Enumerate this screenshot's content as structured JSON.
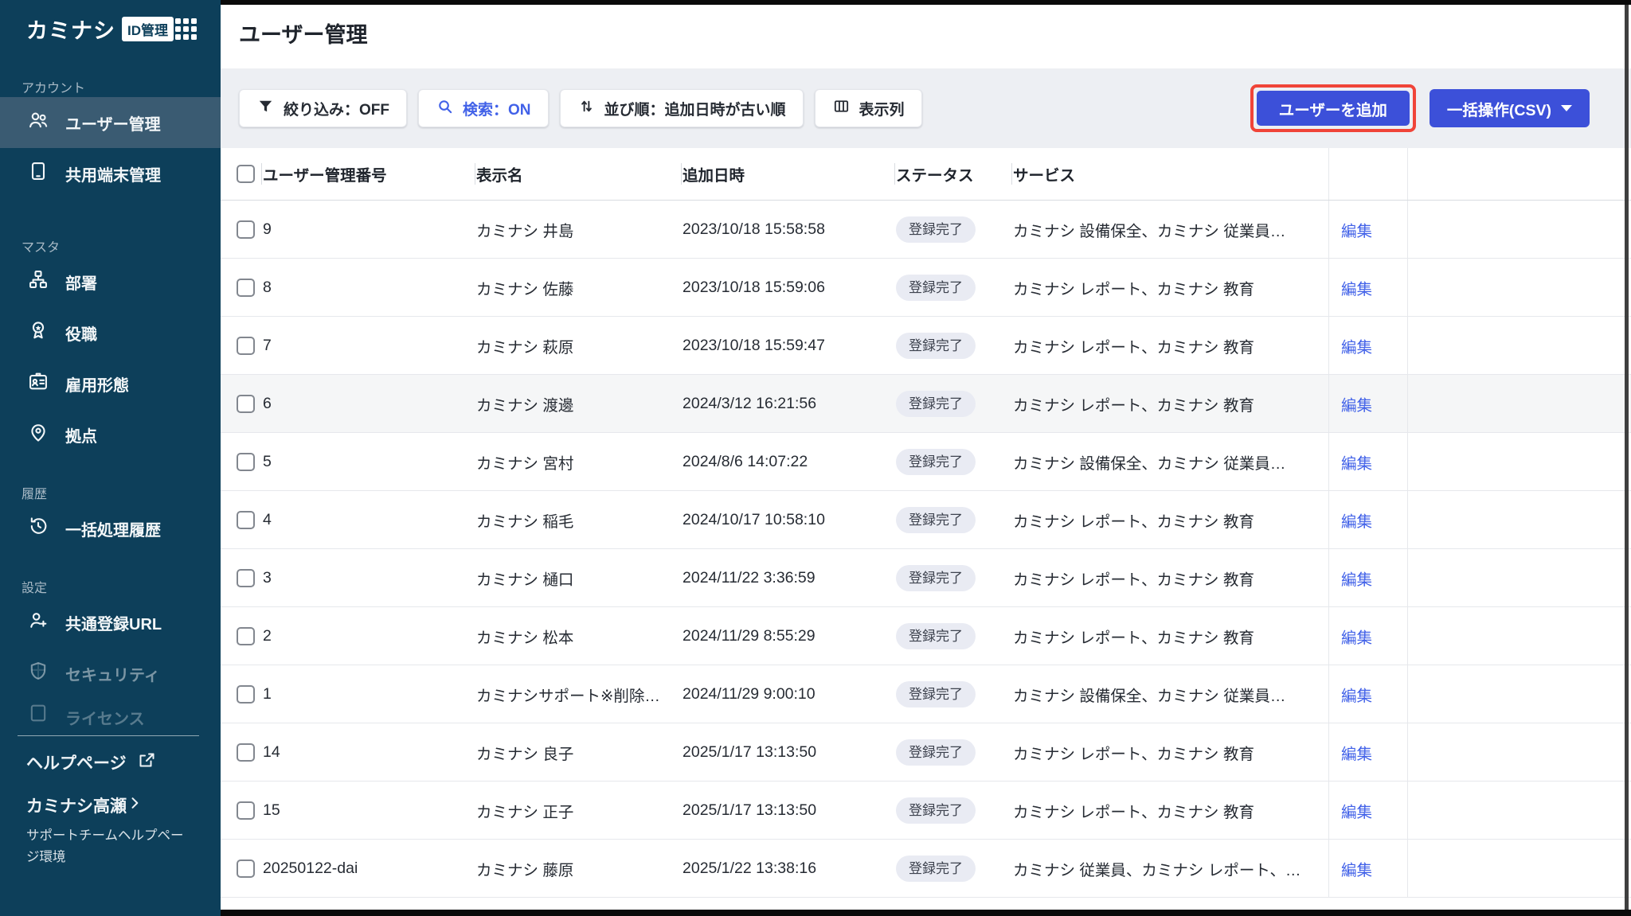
{
  "app": {
    "logo_text": "カミナシ",
    "logo_badge": "ID管理"
  },
  "colors": {
    "navy": "#0d3f5a",
    "navy-active": "#3a5b72",
    "primary": "#3c50d9",
    "red": "#f04438",
    "link": "#4161e8",
    "pill-bg": "#e9ebf3",
    "pill-text": "#3d424e",
    "band": "#edeff3"
  },
  "sidebar": {
    "sections": [
      {
        "label": "アカウント",
        "items": [
          {
            "label": "ユーザー管理"
          },
          {
            "label": "共用端末管理"
          }
        ]
      },
      {
        "label": "マスタ",
        "items": [
          {
            "label": "部署"
          },
          {
            "label": "役職"
          },
          {
            "label": "雇用形態"
          },
          {
            "label": "拠点"
          }
        ]
      },
      {
        "label": "履歴",
        "items": [
          {
            "label": "一括処理履歴"
          }
        ]
      },
      {
        "label": "設定",
        "items": [
          {
            "label": "共通登録URL"
          },
          {
            "label": "セキュリティ"
          },
          {
            "label": "ライセンス"
          }
        ]
      }
    ],
    "footer": {
      "help_label": "ヘルプページ",
      "account_name": "カミナシ高瀬",
      "env_label": "サポートチームヘルプページ環境"
    }
  },
  "header": {
    "title": "ユーザー管理"
  },
  "toolbar": {
    "filter_label": "絞り込み：OFF",
    "search_label": "検索：ON",
    "sort_label": "並び順：追加日時が古い順",
    "columns_label": "表示列",
    "add_user_label": "ユーザーを追加",
    "bulk_label": "一括操作(CSV)"
  },
  "table": {
    "columns": [
      "ユーザー管理番号",
      "表示名",
      "追加日時",
      "ステータス",
      "サービス"
    ],
    "edit_label": "編集",
    "rows": [
      {
        "id": "9",
        "name": "カミナシ 井島",
        "added": "2023/10/18 15:58:58",
        "status": "登録完了",
        "services": "カミナシ 設備保全、カミナシ 従業員…"
      },
      {
        "id": "8",
        "name": "カミナシ 佐藤",
        "added": "2023/10/18 15:59:06",
        "status": "登録完了",
        "services": "カミナシ レポート、カミナシ 教育"
      },
      {
        "id": "7",
        "name": "カミナシ 萩原",
        "added": "2023/10/18 15:59:47",
        "status": "登録完了",
        "services": "カミナシ レポート、カミナシ 教育"
      },
      {
        "id": "6",
        "name": "カミナシ 渡邊",
        "added": "2024/3/12 16:21:56",
        "status": "登録完了",
        "services": "カミナシ レポート、カミナシ 教育",
        "highlighted": true
      },
      {
        "id": "5",
        "name": "カミナシ 宮村",
        "added": "2024/8/6 14:07:22",
        "status": "登録完了",
        "services": "カミナシ 設備保全、カミナシ 従業員…"
      },
      {
        "id": "4",
        "name": "カミナシ 稲毛",
        "added": "2024/10/17 10:58:10",
        "status": "登録完了",
        "services": "カミナシ レポート、カミナシ 教育"
      },
      {
        "id": "3",
        "name": "カミナシ 樋口",
        "added": "2024/11/22 3:36:59",
        "status": "登録完了",
        "services": "カミナシ レポート、カミナシ 教育"
      },
      {
        "id": "2",
        "name": "カミナシ 松本",
        "added": "2024/11/29 8:55:29",
        "status": "登録完了",
        "services": "カミナシ レポート、カミナシ 教育"
      },
      {
        "id": "1",
        "name": "カミナシサポート※削除…",
        "added": "2024/11/29 9:00:10",
        "status": "登録完了",
        "services": "カミナシ 設備保全、カミナシ 従業員…"
      },
      {
        "id": "14",
        "name": "カミナシ 良子",
        "added": "2025/1/17 13:13:50",
        "status": "登録完了",
        "services": "カミナシ レポート、カミナシ 教育"
      },
      {
        "id": "15",
        "name": "カミナシ 正子",
        "added": "2025/1/17 13:13:50",
        "status": "登録完了",
        "services": "カミナシ レポート、カミナシ 教育"
      },
      {
        "id": "20250122-dai",
        "name": "カミナシ 藤原",
        "added": "2025/1/22 13:38:16",
        "status": "登録完了",
        "services": "カミナシ 従業員、カミナシ レポート、…"
      }
    ]
  }
}
